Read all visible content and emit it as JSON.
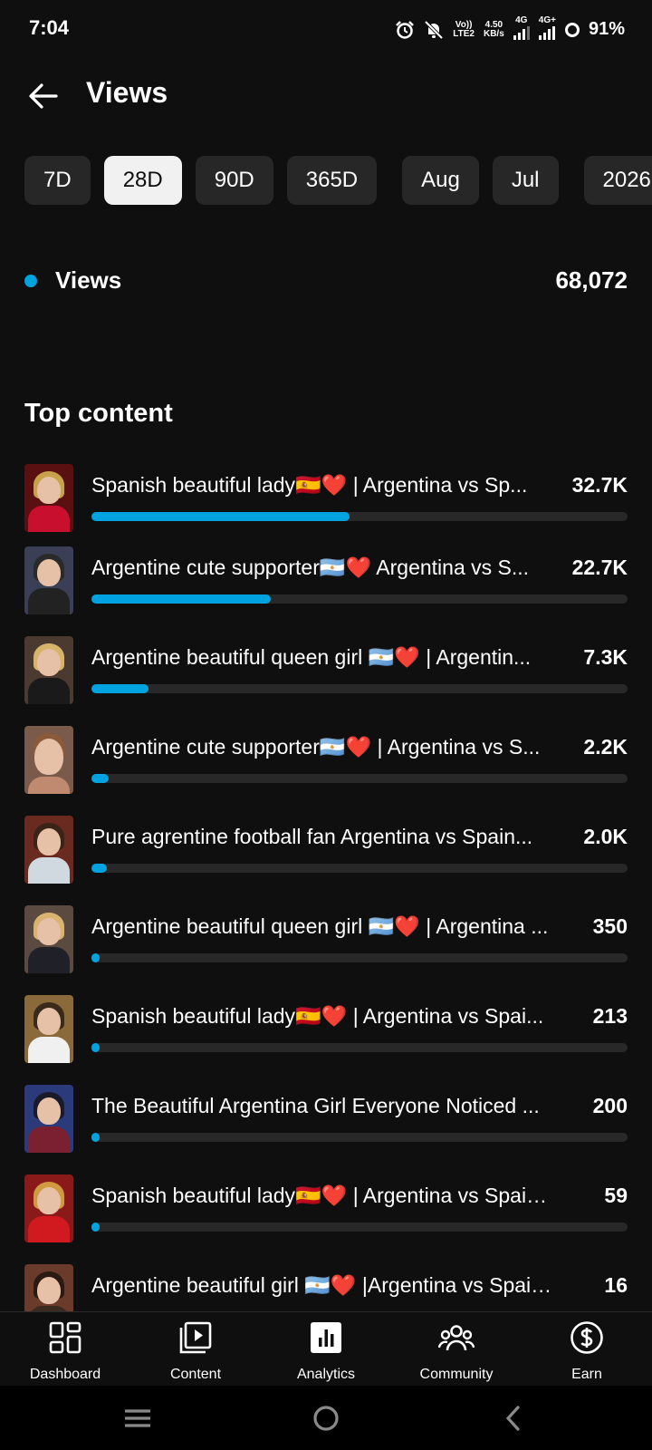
{
  "status_bar": {
    "time": "7:04",
    "volte": "Vo))",
    "lte": "LTE2",
    "speed": "4.50",
    "speed_unit": "KB/s",
    "net1": "4G",
    "net2": "4G+",
    "battery": "91%"
  },
  "header": {
    "title": "Views"
  },
  "period_chips": [
    {
      "label": "7D",
      "active": false
    },
    {
      "label": "28D",
      "active": true
    },
    {
      "label": "90D",
      "active": false
    },
    {
      "label": "365D",
      "active": false
    },
    {
      "label": "Aug",
      "active": false
    },
    {
      "label": "Jul",
      "active": false
    },
    {
      "label": "2026",
      "active": false
    }
  ],
  "summary": {
    "label": "Views",
    "value": "68,072",
    "accent": "#00a3e0"
  },
  "top_content": {
    "title": "Top content",
    "items": [
      {
        "title": "Spanish beautiful lady🇪🇸❤️ | Argentina vs Sp...",
        "value": "32.7K",
        "share": 0.481
      },
      {
        "title": "Argentine cute supporter🇦🇷❤️ Argentina vs S...",
        "value": "22.7K",
        "share": 0.334
      },
      {
        "title": "Argentine beautiful queen girl 🇦🇷❤️ | Argentin...",
        "value": "7.3K",
        "share": 0.107
      },
      {
        "title": "Argentine cute supporter🇦🇷❤️ | Argentina vs S...",
        "value": "2.2K",
        "share": 0.032
      },
      {
        "title": "Pure agrentine football fan Argentina vs Spain...",
        "value": "2.0K",
        "share": 0.029
      },
      {
        "title": "Argentine beautiful queen girl 🇦🇷❤️ | Argentina ...",
        "value": "350",
        "share": 0.005
      },
      {
        "title": "Spanish beautiful lady🇪🇸❤️ | Argentina vs Spai...",
        "value": "213",
        "share": 0.003
      },
      {
        "title": "The Beautiful Argentina Girl Everyone Noticed ...",
        "value": "200",
        "share": 0.003
      },
      {
        "title": "Spanish beautiful lady🇪🇸❤️ | Argentina vs Spain ...",
        "value": "59",
        "share": 0.001
      },
      {
        "title": "Argentine beautiful girl 🇦🇷❤️ |Argentina vs Spain...",
        "value": "16",
        "share": 0.0002
      }
    ]
  },
  "bottom_nav": [
    {
      "label": "Dashboard",
      "icon": "dashboard-icon"
    },
    {
      "label": "Content",
      "icon": "content-icon"
    },
    {
      "label": "Analytics",
      "icon": "analytics-icon"
    },
    {
      "label": "Community",
      "icon": "community-icon"
    },
    {
      "label": "Earn",
      "icon": "earn-icon"
    }
  ]
}
